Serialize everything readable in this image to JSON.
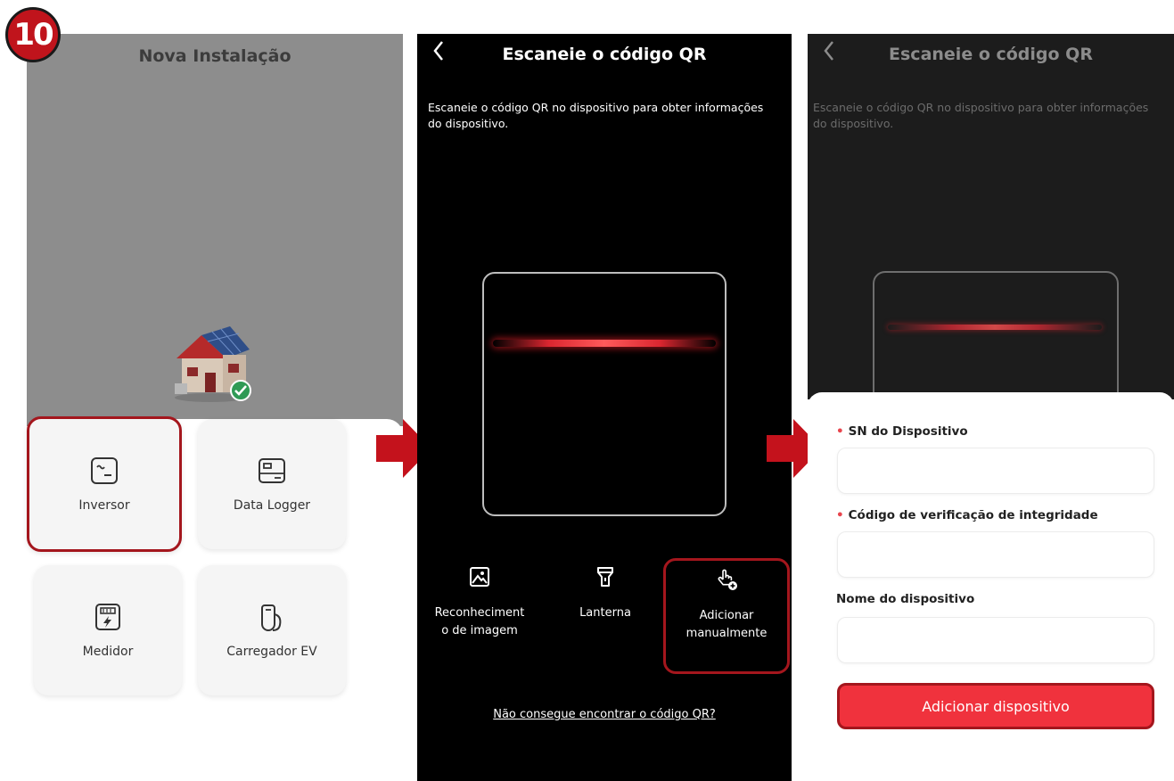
{
  "step_number": "10",
  "screen1": {
    "title": "Nova Instalação",
    "tiles": [
      {
        "label": "Inversor",
        "icon": "inverter-icon",
        "highlighted": true
      },
      {
        "label": "Data Logger",
        "icon": "data-logger-icon"
      },
      {
        "label": "Medidor",
        "icon": "meter-icon"
      },
      {
        "label": "Carregador EV",
        "icon": "ev-charger-icon"
      }
    ]
  },
  "screen2": {
    "title": "Escaneie o código QR",
    "description": "Escaneie o código QR no dispositivo para obter informações do dispositivo.",
    "actions": {
      "image_recognition_line1": "Reconheciment",
      "image_recognition_line2": "o de imagem",
      "lantern": "Lanterna",
      "manual_line1": "Adicionar",
      "manual_line2": "manualmente"
    },
    "help_link": "Não consegue encontrar o código QR?"
  },
  "screen3": {
    "title": "Escaneie o código QR",
    "description": "Escaneie o código QR no dispositivo para obter informações do dispositivo.",
    "fields": {
      "sn_label": "SN do Dispositivo",
      "integrity_label": "Código de verificação de integridade",
      "name_label": "Nome do dispositivo"
    },
    "submit_label": "Adicionar dispositivo"
  },
  "colors": {
    "accent_red": "#f0323d",
    "highlight_red": "#a4161d",
    "required_marker": "#e8454d"
  }
}
